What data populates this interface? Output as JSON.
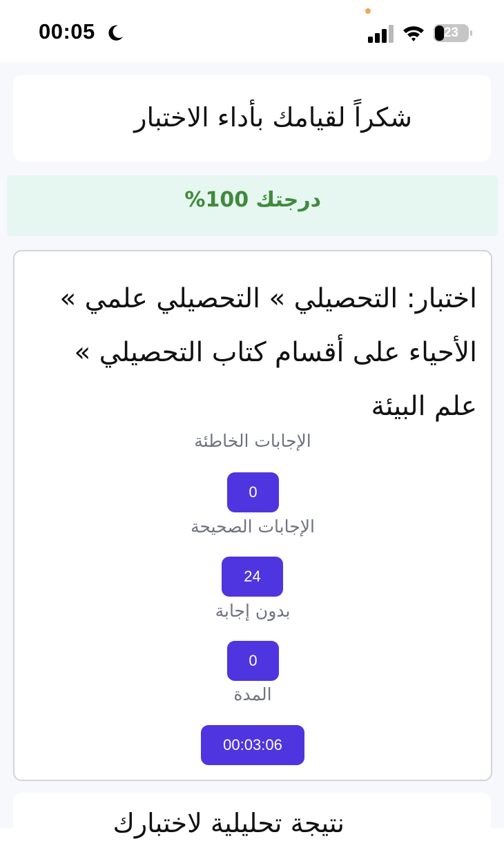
{
  "status_bar": {
    "time": "00:05",
    "battery_level": "23",
    "icons": [
      "moon-icon",
      "signal-icon",
      "wifi-icon",
      "battery-icon"
    ]
  },
  "thanks": {
    "title": "شكراً لقيامك بأداء الاختبار"
  },
  "score": {
    "text": "درجتك 100%"
  },
  "result": {
    "exam_title": "اختبار: التحصيلي » التحصيلي علمي » الأحياء على أقسام كتاب التحصيلي » علم البيئة",
    "stats": [
      {
        "label": "الإجابات الخاطئة",
        "value": "0"
      },
      {
        "label": "الإجابات الصحيحة",
        "value": "24"
      },
      {
        "label": "بدون إجابة",
        "value": "0"
      },
      {
        "label": "المدة",
        "value": "00:03:06"
      }
    ]
  },
  "analysis": {
    "title": "نتيجة تحليلية لاختبارك"
  },
  "colors": {
    "accent": "#4f35df",
    "score_text": "#3f8a3c",
    "score_bg": "#e6f6f0",
    "page_bg": "#f7f8fc",
    "label_gray": "#6f7380"
  }
}
